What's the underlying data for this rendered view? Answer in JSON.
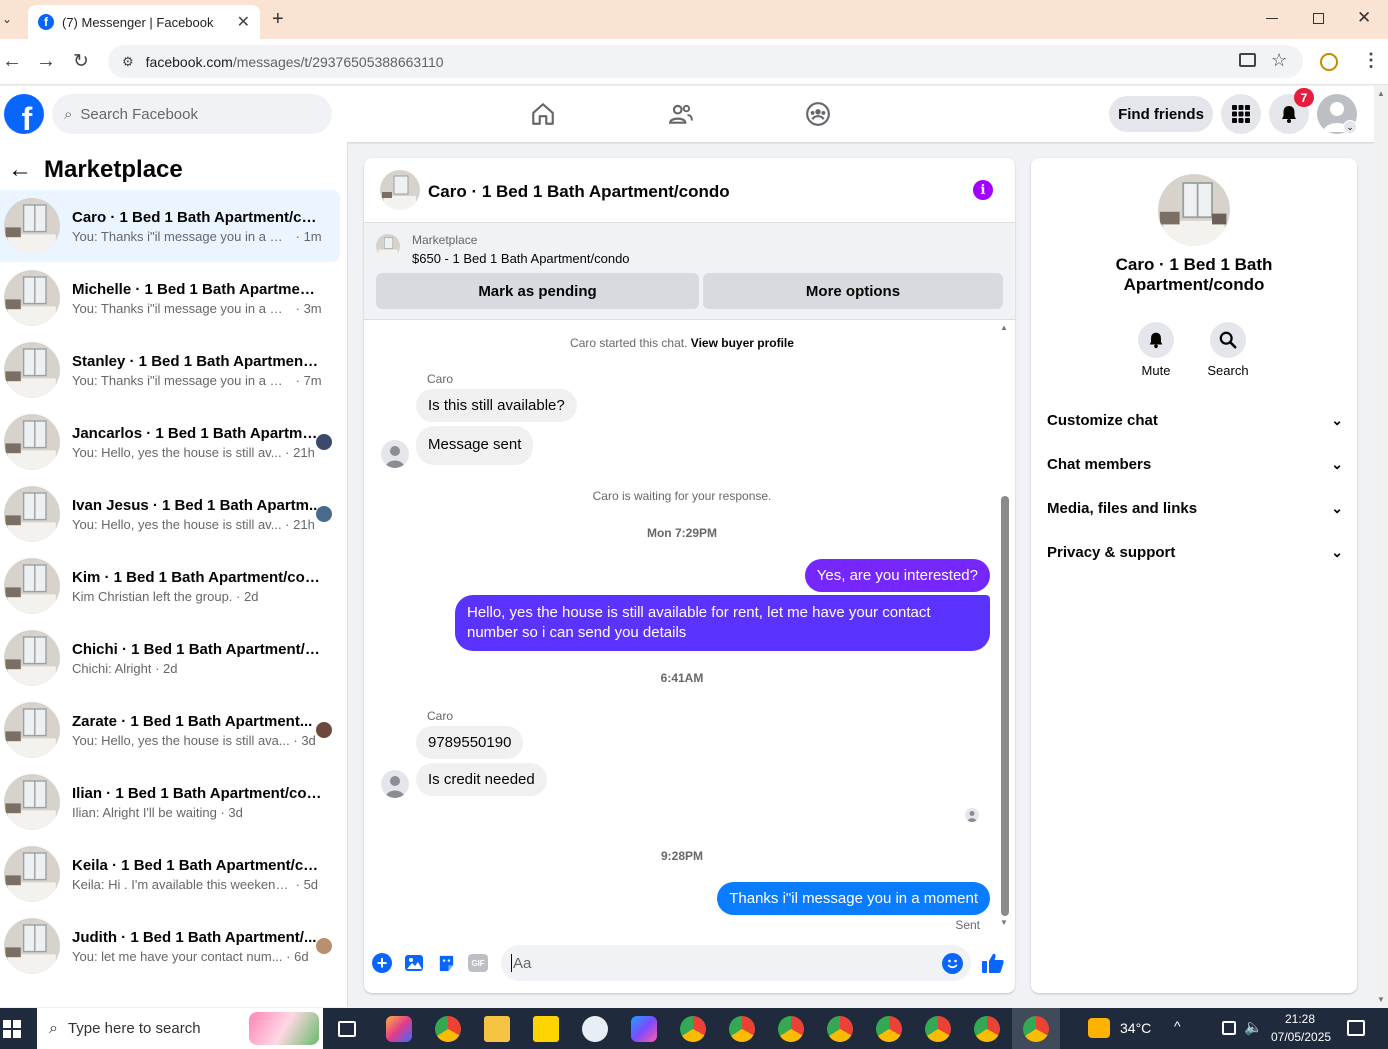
{
  "browser": {
    "tab_title": "(7) Messenger | Facebook",
    "url_host": "facebook.com",
    "url_path": "/messages/t/29376505388663110"
  },
  "header": {
    "search_placeholder": "Search Facebook",
    "find_friends": "Find friends",
    "notification_count": "7"
  },
  "left": {
    "title": "Marketplace",
    "conversations": [
      {
        "title": "Caro · 1 Bed 1 Bath Apartment/con...",
        "preview": "You: Thanks i\"il message you in a mo...",
        "time": "1m",
        "active": true
      },
      {
        "title": "Michelle · 1 Bed 1 Bath Apartment/...",
        "preview": "You: Thanks i\"il message you in a mo...",
        "time": "3m"
      },
      {
        "title": "Stanley · 1 Bed 1 Bath Apartment/c...",
        "preview": "You: Thanks i\"il message you in a mo...",
        "time": "7m"
      },
      {
        "title": "Jancarlos · 1 Bed 1 Bath Apartme...",
        "preview": "You: Hello, yes the house is still av...",
        "time": "21h"
      },
      {
        "title": "Ivan Jesus · 1 Bed 1 Bath Apartm...",
        "preview": "You: Hello, yes the house is still av...",
        "time": "21h"
      },
      {
        "title": "Kim · 1 Bed 1 Bath Apartment/condo",
        "preview": "Kim Christian left the group.",
        "time": "2d"
      },
      {
        "title": "Chichi · 1 Bed 1 Bath Apartment/co...",
        "preview": "Chichi: Alright",
        "time": "2d"
      },
      {
        "title": "Zarate · 1 Bed 1 Bath Apartment...",
        "preview": "You: Hello, yes the house is still ava...",
        "time": "3d"
      },
      {
        "title": "Ilian · 1 Bed 1 Bath Apartment/con...",
        "preview": "Ilian: Alright I'll be waiting",
        "time": "3d"
      },
      {
        "title": "Keila · 1 Bed 1 Bath Apartment/con...",
        "preview": "Keila: Hi . I'm available this weekend t...",
        "time": "5d"
      },
      {
        "title": "Judith · 1 Bed 1 Bath Apartment/...",
        "preview": "You: let me have your contact num...",
        "time": "6d"
      }
    ]
  },
  "chat": {
    "title": "Caro · 1 Bed 1 Bath Apartment/condo",
    "listing_label": "Marketplace",
    "listing_price": "$650 - 1 Bed 1 Bath Apartment/condo",
    "mark_pending": "Mark as pending",
    "more_options": "More options",
    "started_text": "Caro started this chat.",
    "view_profile": "View buyer profile",
    "sender1": "Caro",
    "msg1": "Is this still available?",
    "msg2": "Message sent",
    "waiting": "Caro is waiting for your response.",
    "time1": "Mon 7:29PM",
    "out1": "Yes, are you interested?",
    "out2": "Hello, yes the house is still available for rent, let me have your contact number so i can send you details",
    "time2": "6:41AM",
    "sender2": "Caro",
    "msg3": "9789550190",
    "msg4": "Is credit needed",
    "time3": "9:28PM",
    "out3": "Thanks i\"il message you in a moment",
    "sent_label": "Sent",
    "composer_placeholder": "Aa"
  },
  "right": {
    "name": "Caro · 1 Bed 1 Bath Apartment/condo",
    "mute": "Mute",
    "search": "Search",
    "sections": [
      "Customize chat",
      "Chat members",
      "Media, files and links",
      "Privacy & support"
    ]
  },
  "taskbar": {
    "search_placeholder": "Type here to search",
    "temperature": "34°C",
    "time": "21:28",
    "date": "07/05/2025"
  },
  "colors": {
    "facebook_blue": "#0866ff",
    "messenger_purple": "#6a2bff",
    "outgoing_blue": "#0a7cff"
  }
}
